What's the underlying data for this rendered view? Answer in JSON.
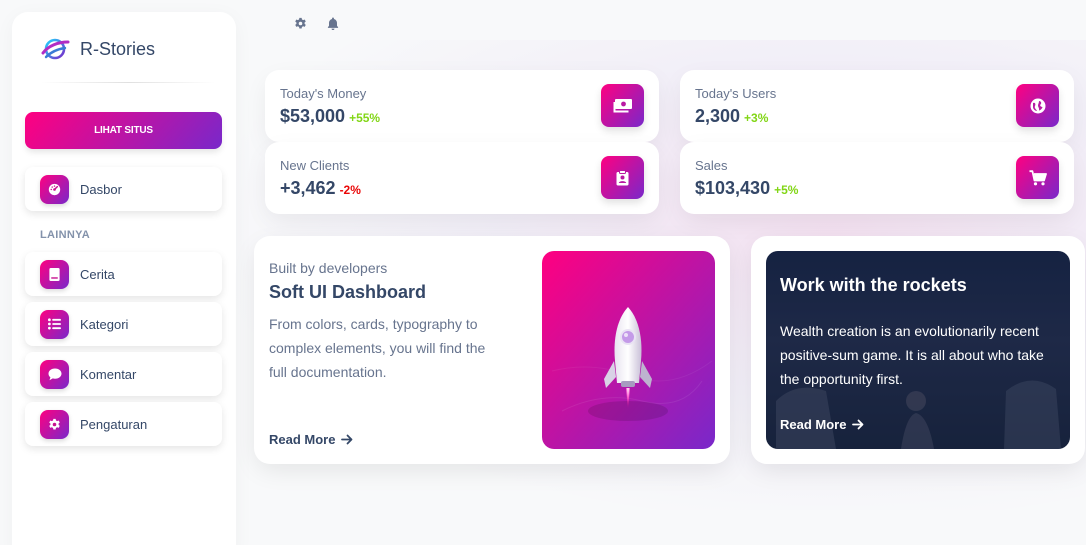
{
  "sidebar": {
    "brand": "R-Stories",
    "cta_label": "LIHAT SITUS",
    "primary_item": {
      "label": "Dasbor",
      "icon": "gauge-icon"
    },
    "section_title": "LAINNYA",
    "items": [
      {
        "label": "Cerita",
        "icon": "book-icon"
      },
      {
        "label": "Kategori",
        "icon": "list-icon"
      },
      {
        "label": "Komentar",
        "icon": "comment-icon"
      },
      {
        "label": "Pengaturan",
        "icon": "gear-icon"
      }
    ]
  },
  "topbar": {
    "icons": [
      "gear-icon",
      "bell-icon"
    ]
  },
  "stats": [
    {
      "label": "Today's Money",
      "value": "$53,000",
      "change": "+55%",
      "trend": "up",
      "icon": "money-icon"
    },
    {
      "label": "Today's Users",
      "value": "2,300",
      "change": "+3%",
      "trend": "up",
      "icon": "globe-icon"
    },
    {
      "label": "New Clients",
      "value": "+3,462",
      "change": "-2%",
      "trend": "down",
      "icon": "clipboard-icon"
    },
    {
      "label": "Sales",
      "value": "$103,430",
      "change": "+5%",
      "trend": "up",
      "icon": "cart-icon"
    }
  ],
  "promo": {
    "eyebrow": "Built by developers",
    "title": "Soft UI Dashboard",
    "text": "From colors, cards, typography to complex elements, you will find the full documentation.",
    "link": "Read More"
  },
  "rockets": {
    "title": "Work with the rockets",
    "text": "Wealth creation is an evolutionarily recent positive-sum game. It is all about who take the opportunity first.",
    "link": "Read More"
  },
  "colors": {
    "gradient_start": "#ff0080",
    "gradient_end": "#7928ca",
    "text_dark": "#344767",
    "text_muted": "#67748e",
    "positive": "#82d616",
    "negative": "#ea0606"
  }
}
